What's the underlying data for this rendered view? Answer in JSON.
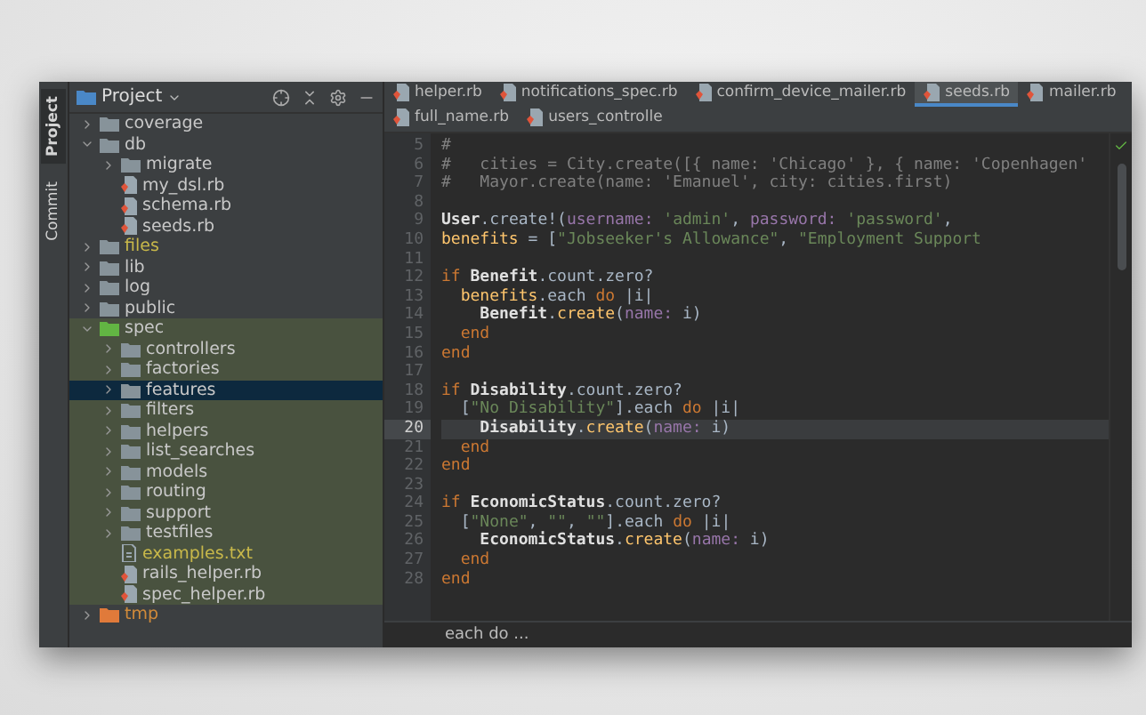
{
  "tool_strip": [
    {
      "label": "Project",
      "selected": true
    },
    {
      "label": "Commit",
      "selected": false
    }
  ],
  "project_panel": {
    "title": "Project",
    "tree": [
      {
        "name": "coverage",
        "kind": "folder",
        "expanded": false
      },
      {
        "name": "db",
        "kind": "folder",
        "expanded": true,
        "children": [
          {
            "name": "migrate",
            "kind": "folder",
            "expanded": false
          },
          {
            "name": "my_dsl.rb",
            "kind": "ruby"
          },
          {
            "name": "schema.rb",
            "kind": "ruby"
          },
          {
            "name": "seeds.rb",
            "kind": "ruby"
          }
        ]
      },
      {
        "name": "files",
        "kind": "folder",
        "expanded": false,
        "unversioned": true
      },
      {
        "name": "lib",
        "kind": "folder",
        "expanded": false
      },
      {
        "name": "log",
        "kind": "folder",
        "expanded": false
      },
      {
        "name": "public",
        "kind": "folder",
        "expanded": false
      },
      {
        "name": "spec",
        "kind": "test_folder",
        "expanded": true,
        "children": [
          {
            "name": "controllers",
            "kind": "folder",
            "expanded": false
          },
          {
            "name": "factories",
            "kind": "folder",
            "expanded": false
          },
          {
            "name": "features",
            "kind": "folder",
            "expanded": false,
            "selected": true
          },
          {
            "name": "filters",
            "kind": "folder",
            "expanded": false
          },
          {
            "name": "helpers",
            "kind": "folder",
            "expanded": false
          },
          {
            "name": "list_searches",
            "kind": "folder",
            "expanded": false
          },
          {
            "name": "models",
            "kind": "folder",
            "expanded": false
          },
          {
            "name": "routing",
            "kind": "folder",
            "expanded": false
          },
          {
            "name": "support",
            "kind": "folder",
            "expanded": false
          },
          {
            "name": "testfiles",
            "kind": "folder",
            "expanded": false
          },
          {
            "name": "examples.txt",
            "kind": "text",
            "unversioned": true
          },
          {
            "name": "rails_helper.rb",
            "kind": "ruby"
          },
          {
            "name": "spec_helper.rb",
            "kind": "ruby"
          }
        ]
      },
      {
        "name": "tmp",
        "kind": "excluded_folder",
        "expanded": false
      }
    ]
  },
  "editor": {
    "tabs": [
      {
        "label": "helper.rb",
        "selected": false
      },
      {
        "label": "notifications_spec.rb",
        "selected": false
      },
      {
        "label": "confirm_device_mailer.rb",
        "selected": false
      },
      {
        "label": "seeds.rb",
        "selected": true
      },
      {
        "label": "mailer.rb",
        "selected": false
      },
      {
        "label": "full_name.rb",
        "selected": false
      },
      {
        "label": "users_controlle",
        "selected": false
      }
    ],
    "lines": [
      {
        "number": "5",
        "current": false,
        "tokens": [
          {
            "kind": "comment",
            "text": "#"
          }
        ]
      },
      {
        "number": "6",
        "current": false,
        "tokens": [
          {
            "kind": "comment",
            "text": "#   cities = City.create([{ name: 'Chicago' }, { name: 'Copenhagen'"
          }
        ]
      },
      {
        "number": "7",
        "current": false,
        "tokens": [
          {
            "kind": "comment",
            "text": "#   Mayor.create(name: 'Emanuel', city: cities.first)"
          }
        ]
      },
      {
        "number": "8",
        "current": false
      },
      {
        "number": "9",
        "current": false,
        "tokens": [
          {
            "kind": "const",
            "text": "User"
          },
          {
            "kind": "plain",
            "text": ".create!("
          },
          {
            "kind": "sym",
            "text": "username:"
          },
          {
            "kind": "str",
            "text": " 'admin'"
          },
          {
            "kind": "plain",
            "text": ", "
          },
          {
            "kind": "sym",
            "text": "password:"
          },
          {
            "kind": "str",
            "text": " 'password'"
          },
          {
            "kind": "plain",
            "text": ","
          }
        ]
      },
      {
        "number": "10",
        "current": false,
        "tokens": [
          {
            "kind": "var",
            "text": "benefits"
          },
          {
            "kind": "plain",
            "text": " = ["
          },
          {
            "kind": "str",
            "text": "\"Jobseeker's Allowance\""
          },
          {
            "kind": "plain",
            "text": ", "
          },
          {
            "kind": "str",
            "text": "\"Employment Support"
          }
        ]
      },
      {
        "number": "11",
        "current": false
      },
      {
        "number": "12",
        "current": false,
        "tokens": [
          {
            "kind": "kw",
            "text": "if "
          },
          {
            "kind": "const",
            "text": "Benefit"
          },
          {
            "kind": "plain",
            "text": ".count.zero?"
          }
        ]
      },
      {
        "number": "13",
        "current": false,
        "tokens": [
          {
            "kind": "var",
            "text": "  benefits"
          },
          {
            "kind": "plain",
            "text": ".each "
          },
          {
            "kind": "kw",
            "text": "do"
          },
          {
            "kind": "plain",
            "text": " |i|"
          }
        ]
      },
      {
        "number": "14",
        "current": false,
        "tokens": [
          {
            "kind": "const",
            "text": "    Benefit"
          },
          {
            "kind": "plain",
            "text": "."
          },
          {
            "kind": "method",
            "text": "create"
          },
          {
            "kind": "plain",
            "text": "("
          },
          {
            "kind": "sym",
            "text": "name:"
          },
          {
            "kind": "plain",
            "text": " i)"
          }
        ]
      },
      {
        "number": "15",
        "current": false,
        "tokens": [
          {
            "kind": "kw",
            "text": "  end"
          }
        ]
      },
      {
        "number": "16",
        "current": false,
        "tokens": [
          {
            "kind": "kw",
            "text": "end"
          }
        ]
      },
      {
        "number": "17",
        "current": false
      },
      {
        "number": "18",
        "current": false,
        "tokens": [
          {
            "kind": "kw",
            "text": "if "
          },
          {
            "kind": "const",
            "text": "Disability"
          },
          {
            "kind": "plain",
            "text": ".count.zero?"
          }
        ]
      },
      {
        "number": "19",
        "current": false,
        "tokens": [
          {
            "kind": "plain",
            "text": "  ["
          },
          {
            "kind": "str",
            "text": "\"No Disability\""
          },
          {
            "kind": "plain",
            "text": "].each "
          },
          {
            "kind": "kw",
            "text": "do"
          },
          {
            "kind": "plain",
            "text": " |i|"
          }
        ]
      },
      {
        "number": "20",
        "current": true,
        "tokens": [
          {
            "kind": "const",
            "text": "    Disability"
          },
          {
            "kind": "plain",
            "text": "."
          },
          {
            "kind": "method",
            "text": "create"
          },
          {
            "kind": "plain",
            "text": "("
          },
          {
            "kind": "sym",
            "text": "name:"
          },
          {
            "kind": "plain",
            "text": " i)"
          }
        ]
      },
      {
        "number": "21",
        "current": false,
        "tokens": [
          {
            "kind": "kw",
            "text": "  end"
          }
        ]
      },
      {
        "number": "22",
        "current": false,
        "tokens": [
          {
            "kind": "kw",
            "text": "end"
          }
        ]
      },
      {
        "number": "23",
        "current": false
      },
      {
        "number": "24",
        "current": false,
        "tokens": [
          {
            "kind": "kw",
            "text": "if "
          },
          {
            "kind": "const",
            "text": "EconomicStatus"
          },
          {
            "kind": "plain",
            "text": ".count.zero?"
          }
        ]
      },
      {
        "number": "25",
        "current": false,
        "tokens": [
          {
            "kind": "plain",
            "text": "  ["
          },
          {
            "kind": "str",
            "text": "\"None\""
          },
          {
            "kind": "plain",
            "text": ", "
          },
          {
            "kind": "str",
            "text": "\"\""
          },
          {
            "kind": "plain",
            "text": ", "
          },
          {
            "kind": "str",
            "text": "\"\""
          },
          {
            "kind": "plain",
            "text": "].each "
          },
          {
            "kind": "kw",
            "text": "do"
          },
          {
            "kind": "plain",
            "text": " |i|"
          }
        ]
      },
      {
        "number": "26",
        "current": false,
        "tokens": [
          {
            "kind": "const",
            "text": "    EconomicStatus"
          },
          {
            "kind": "plain",
            "text": "."
          },
          {
            "kind": "method",
            "text": "create"
          },
          {
            "kind": "plain",
            "text": "("
          },
          {
            "kind": "sym",
            "text": "name:"
          },
          {
            "kind": "plain",
            "text": " i)"
          }
        ]
      },
      {
        "number": "27",
        "current": false,
        "tokens": [
          {
            "kind": "kw",
            "text": "  end"
          }
        ]
      },
      {
        "number": "28",
        "current": false,
        "tokens": [
          {
            "kind": "kw",
            "text": "end"
          }
        ]
      }
    ],
    "breadcrumb": "each do ..."
  }
}
